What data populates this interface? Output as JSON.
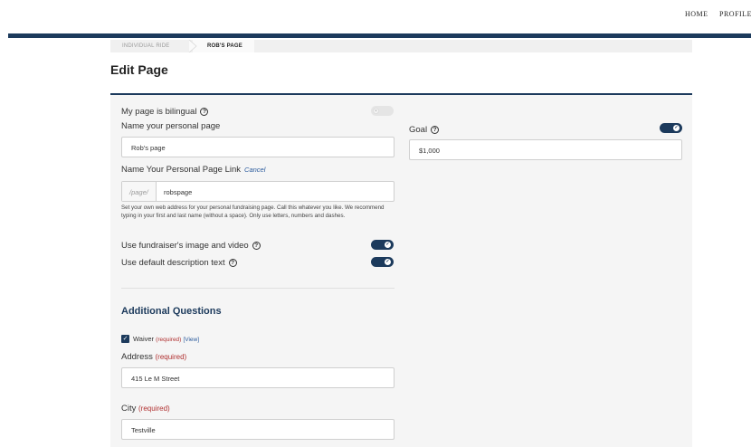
{
  "nav": {
    "home": "HOME",
    "profile": "PROFILE"
  },
  "breadcrumb": {
    "items": [
      "INDIVIDUAL RIDE",
      "ROB'S PAGE"
    ]
  },
  "page": {
    "title": "Edit Page"
  },
  "form": {
    "bilingual_label": "My page is bilingual",
    "bilingual_on": false,
    "name_label": "Name your personal page",
    "name_value": "Rob's page",
    "link_label": "Name Your Personal Page Link",
    "cancel_label": "Cancel",
    "link_prefix": "/page/",
    "link_value": "robspage",
    "link_help": "Set your own web address for your personal fundraising page. Call this whatever you like. We recommend typing in your first and last name (without a space). Only use letters, numbers and dashes.",
    "use_image_label": "Use fundraiser's image and video",
    "use_image_on": true,
    "use_desc_label": "Use default description text",
    "use_desc_on": true,
    "goal_label": "Goal",
    "goal_on": true,
    "goal_value": "$1,000"
  },
  "questions": {
    "title": "Additional Questions",
    "waiver_label": "Waiver",
    "waiver_required": "(required)",
    "waiver_view": "[View]",
    "waiver_checked": true,
    "address_label": "Address",
    "address_required": "(required)",
    "address_value": "415 Le M Street",
    "city_label": "City",
    "city_required": "(required)",
    "city_value": "Testville"
  },
  "icons": {
    "help": "question-circle-icon",
    "check": "check-icon"
  },
  "colors": {
    "primary": "#1c3a5c",
    "required": "#b03030",
    "link": "#2a5a9c"
  }
}
